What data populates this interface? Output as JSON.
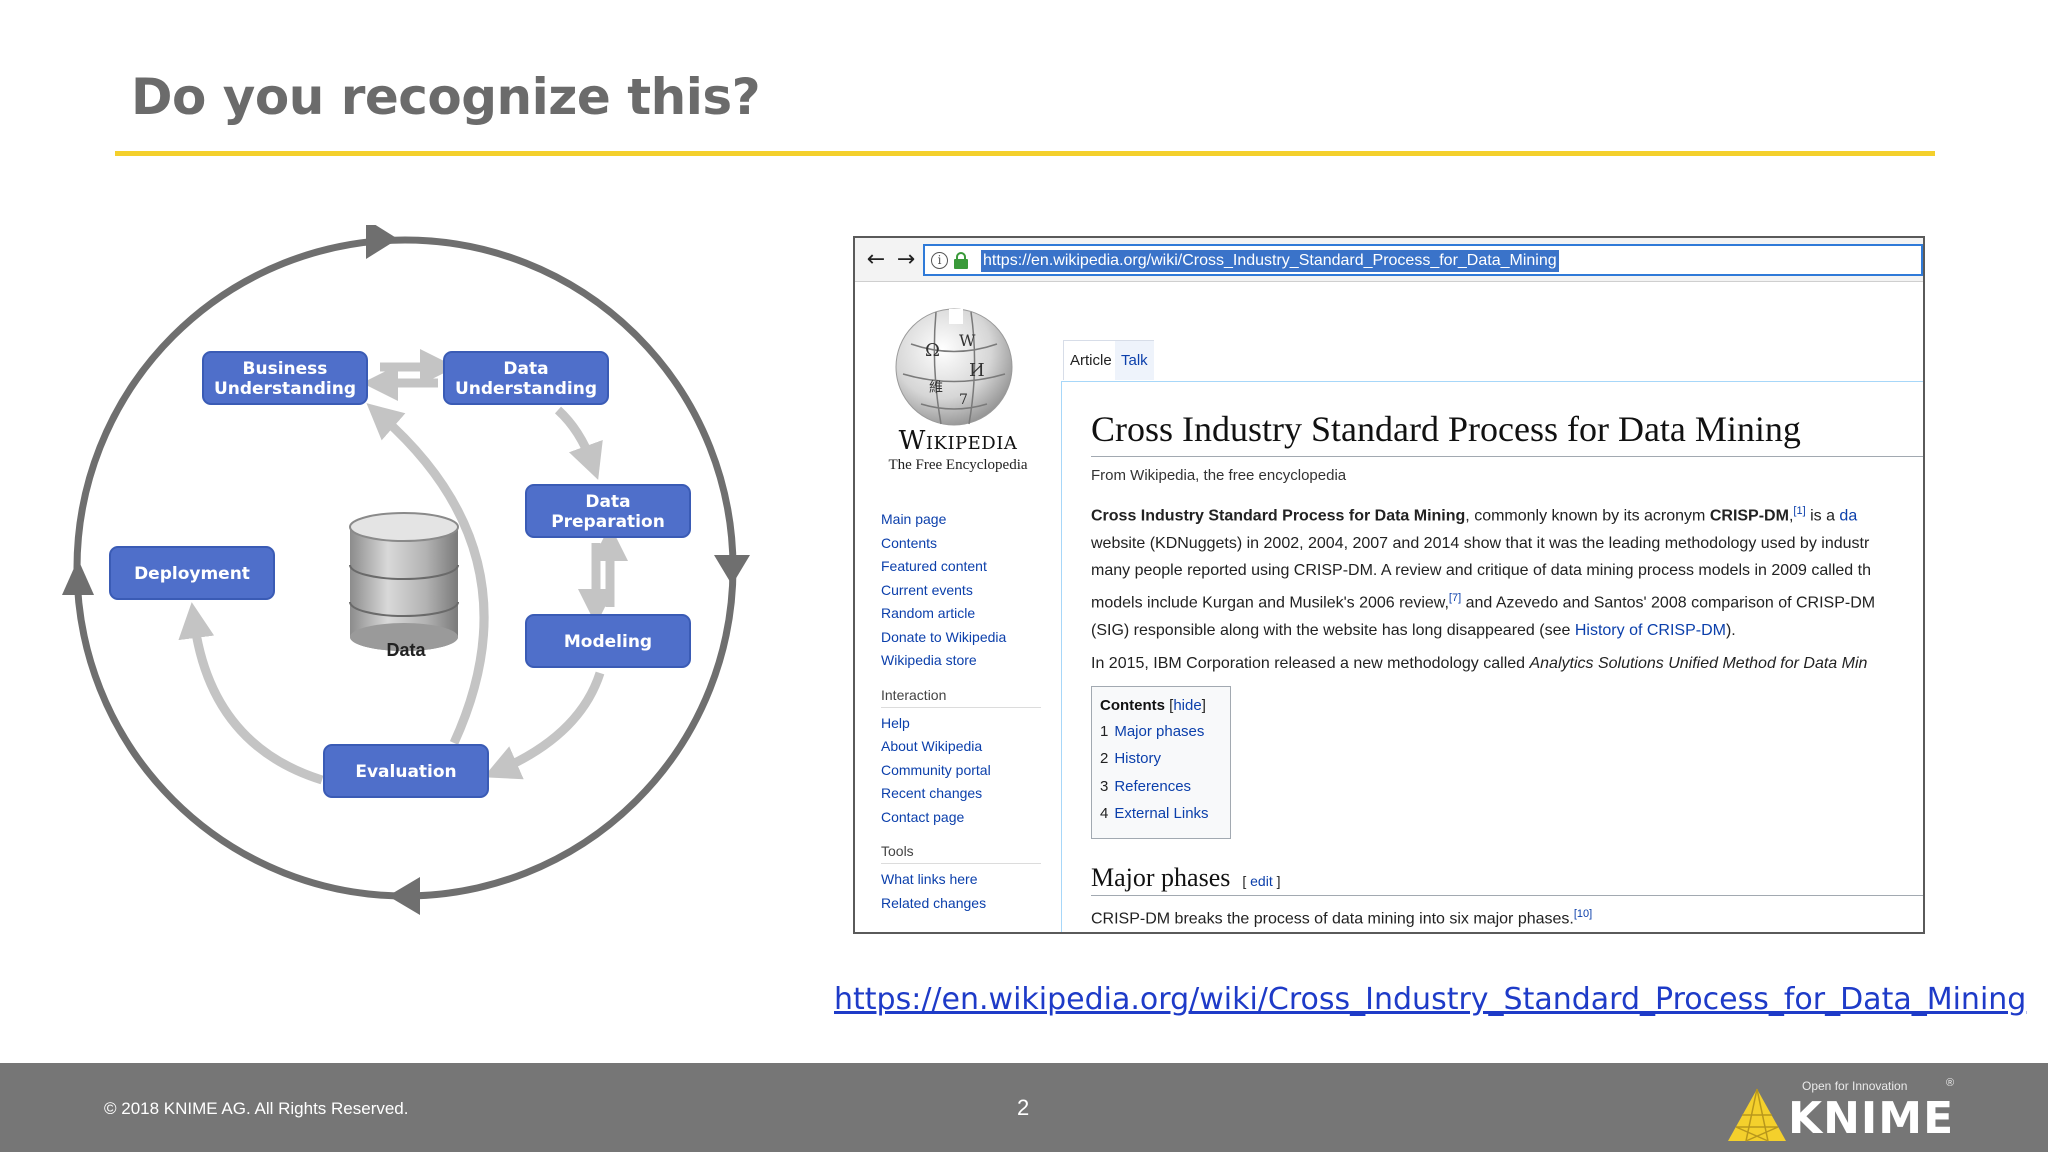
{
  "slide": {
    "title": "Do you recognize this?",
    "link": "https://en.wikipedia.org/wiki/Cross_Industry_Standard_Process_for_Data_Mining"
  },
  "diagram": {
    "phases": {
      "business_understanding": [
        "Business",
        "Understanding"
      ],
      "data_understanding": [
        "Data",
        "Understanding"
      ],
      "data_preparation": [
        "Data",
        "Preparation"
      ],
      "modeling": "Modeling",
      "evaluation": "Evaluation",
      "deployment": "Deployment"
    },
    "center_label": "Data",
    "colors": {
      "box": "#4f6fca",
      "box_border": "#3a5bb5",
      "arrow": "#c4c4c4",
      "cycle": "#6f6f6f"
    }
  },
  "browser": {
    "url": "https://en.wikipedia.org/wiki/Cross_Industry_Standard_Process_for_Data_Mining",
    "wikipedia": {
      "wordmark": "Wikipedia",
      "tagline": "The Free Encyclopedia",
      "nav_links": [
        "Main page",
        "Contents",
        "Featured content",
        "Current events",
        "Random article",
        "Donate to Wikipedia",
        "Wikipedia store"
      ],
      "interaction_heading": "Interaction",
      "interaction_links": [
        "Help",
        "About Wikipedia",
        "Community portal",
        "Recent changes",
        "Contact page"
      ],
      "tools_heading": "Tools",
      "tools_links": [
        "What links here",
        "Related changes"
      ],
      "tabs": {
        "article": "Article",
        "talk": "Talk"
      },
      "article": {
        "title": "Cross Industry Standard Process for Data Mining",
        "from": "From Wikipedia, the free encyclopedia",
        "p1_bold": "Cross Industry Standard Process for Data Mining",
        "p1_a": ", commonly known by its acronym ",
        "p1_acronym": "CRISP-DM",
        "p1_b": ",",
        "p1_ref": "[1]",
        "p1_c": " is a ",
        "p1_link": "da",
        "line2": "website (KDNuggets) in 2002, 2004, 2007 and 2014 show that it was the leading methodology used by industr",
        "line3": "many people reported using CRISP-DM. A review and critique of data mining process models in 2009 called th",
        "line4_a": "models include Kurgan and Musilek's 2006 review,",
        "line4_ref": "[7]",
        "line4_b": " and Azevedo and Santos' 2008 comparison of CRISP-DM",
        "line5_a": "(SIG) responsible along with the website has long disappeared (see ",
        "line5_link": "History of CRISP-DM",
        "line5_b": ").",
        "p2_a": "In 2015, IBM Corporation released a new methodology called ",
        "p2_italic": "Analytics Solutions Unified Method for Data Min",
        "toc": {
          "heading": "Contents",
          "hide": "hide",
          "items": [
            {
              "num": "1",
              "label": "Major phases"
            },
            {
              "num": "2",
              "label": "History"
            },
            {
              "num": "3",
              "label": "References"
            },
            {
              "num": "4",
              "label": "External Links"
            }
          ]
        },
        "section_title": "Major phases",
        "section_edit": "edit",
        "cut_a": "CRISP-DM breaks the process of ",
        "cut_link": "data mining",
        "cut_b": " into six major phases.",
        "cut_ref": "[10]"
      }
    }
  },
  "footer": {
    "copyright": "© 2018 KNIME AG. All Rights Reserved.",
    "page_number": "2",
    "logo_tagline": "Open for Innovation",
    "logo_text": "KNIME",
    "logo_reg": "®"
  }
}
